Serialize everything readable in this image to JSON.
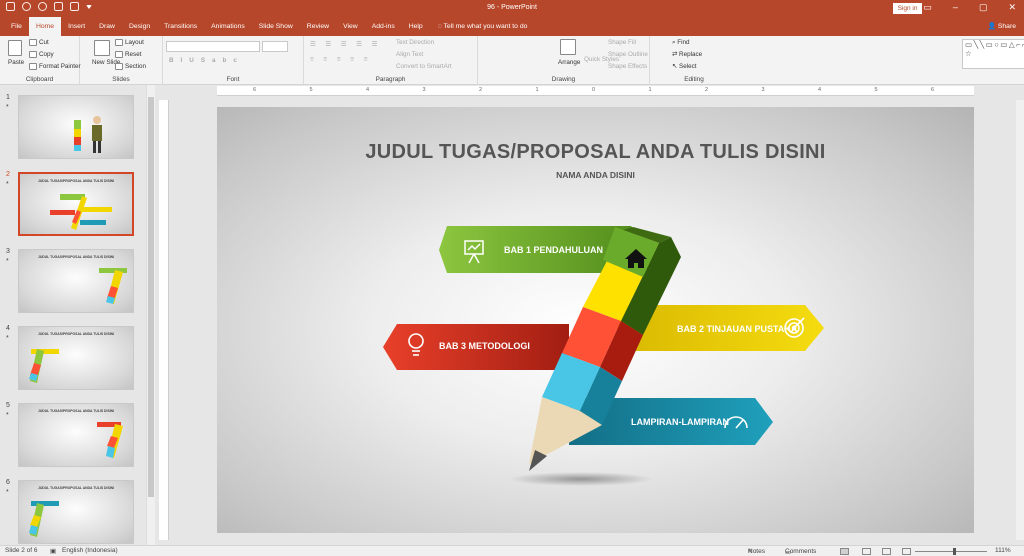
{
  "window": {
    "title": "96 - PowerPoint",
    "signin": "Sign in"
  },
  "menu": {
    "tabs": [
      "File",
      "Home",
      "Insert",
      "Draw",
      "Design",
      "Transitions",
      "Animations",
      "Slide Show",
      "Review",
      "View",
      "Add-ins",
      "Help"
    ],
    "active": "Home",
    "tell_me": "Tell me what you want to do",
    "share": "Share"
  },
  "ribbon": {
    "clipboard": {
      "label": "Clipboard",
      "paste": "Paste",
      "cut": "Cut",
      "copy": "Copy",
      "format_painter": "Format Painter"
    },
    "slides": {
      "label": "Slides",
      "new_slide": "New Slide",
      "layout": "Layout",
      "reset": "Reset",
      "section": "Section"
    },
    "font": {
      "label": "Font"
    },
    "paragraph": {
      "label": "Paragraph",
      "text_direction": "Text Direction",
      "align_text": "Align Text",
      "convert_smartart": "Convert to SmartArt"
    },
    "drawing": {
      "label": "Drawing",
      "arrange": "Arrange",
      "quick_styles": "Quick Styles",
      "shape_fill": "Shape Fill",
      "shape_outline": "Shape Outline",
      "shape_effects": "Shape Effects"
    },
    "editing": {
      "label": "Editing",
      "find": "Find",
      "replace": "Replace",
      "select": "Select"
    }
  },
  "thumbnails": [
    {
      "num": "1",
      "star": "*"
    },
    {
      "num": "2",
      "star": "*",
      "title": "JUDUL TUGAS/PROPOSAL ANDA TULIS DISINI",
      "selected": true
    },
    {
      "num": "3",
      "star": "*",
      "title": "JUDUL TUGAS/PROPOSAL ANDA TULIS DISINI"
    },
    {
      "num": "4",
      "star": "*",
      "title": "JUDUL TUGAS/PROPOSAL ANDA TULIS DISINI"
    },
    {
      "num": "5",
      "star": "*",
      "title": "JUDUL TUGAS/PROPOSAL ANDA TULIS DISINI"
    },
    {
      "num": "6",
      "star": "*",
      "title": "JUDUL TUGAS/PROPOSAL ANDA TULIS DISINI"
    }
  ],
  "ruler": {
    "labels": [
      "6",
      "5",
      "4",
      "3",
      "2",
      "1",
      "0",
      "1",
      "2",
      "3",
      "4",
      "5",
      "6"
    ]
  },
  "slide": {
    "title": "JUDUL TUGAS/PROPOSAL ANDA TULIS DISINI",
    "subtitle": "NAMA ANDA DISINI",
    "items": [
      {
        "label": "BAB 1 PENDAHULUAN",
        "color": "#8dc63f",
        "icon": "presentation-board-icon"
      },
      {
        "label": "BAB 2 TINJAUAN PUSTAKA",
        "color": "#f2d600",
        "icon": "target-icon"
      },
      {
        "label": "BAB 3 METODOLOGI",
        "color": "#e8402a",
        "icon": "lightbulb-icon"
      },
      {
        "label": "LAMPIRAN-LAMPIRAN",
        "color": "#1f9bb5",
        "icon": "speedometer-icon"
      }
    ],
    "pencil_cap_icon": "house-icon"
  },
  "status": {
    "slide_of": "Slide 2 of 6",
    "language": "English (Indonesia)",
    "notes": "Notes",
    "comments": "Comments",
    "zoom": "111%"
  }
}
